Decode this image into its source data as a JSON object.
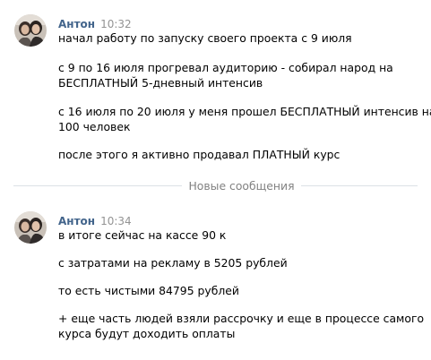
{
  "messages": [
    {
      "author": "Антон",
      "time": "10:32",
      "lines": [
        "начал работу по запуску своего проекта с 9 июля",
        "с 9 по 16 июля прогревал аудиторию - собирал народ на",
        "БЕСПЛАТНЫЙ 5-дневный интенсив",
        "с 16 июля по 20 июля у меня прошел БЕСПЛАТНЫЙ интенсив на",
        "100 человек",
        "после этого я активно продавал ПЛАТНЫЙ курс"
      ]
    },
    {
      "author": "Антон",
      "time": "10:34",
      "lines": [
        "в итоге сейчас на кассе 90 к",
        "с затратами на рекламу в 5205 рублей",
        "то есть чистыми 84795 рублей",
        "+ еще часть людей взяли рассрочку и еще в процессе самого",
        "курса будут доходить оплаты"
      ]
    }
  ],
  "divider": {
    "label": "Новые сообщения"
  },
  "colors": {
    "author": "#42648b",
    "time": "#939393",
    "divider_text": "#828282",
    "divider_line": "#dce1e6"
  },
  "icons": {
    "avatar": "user-photo-avatar"
  }
}
